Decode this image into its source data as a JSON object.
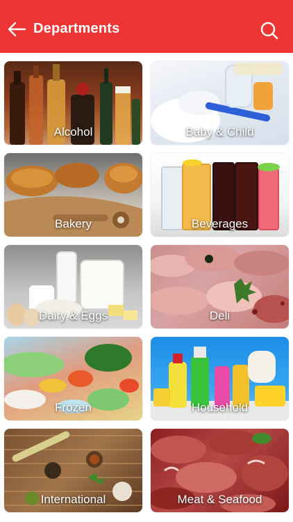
{
  "header": {
    "title": "Departments",
    "back_icon": "arrow-left-icon",
    "search_icon": "search-icon",
    "background": "#ee3535"
  },
  "departments": [
    {
      "label": "Alcohol"
    },
    {
      "label": "Baby & Child"
    },
    {
      "label": "Bakery"
    },
    {
      "label": "Beverages"
    },
    {
      "label": "Dairy & Eggs"
    },
    {
      "label": "Deli"
    },
    {
      "label": "Frozen"
    },
    {
      "label": "Household"
    },
    {
      "label": "International"
    },
    {
      "label": "Meat & Seafood"
    }
  ]
}
